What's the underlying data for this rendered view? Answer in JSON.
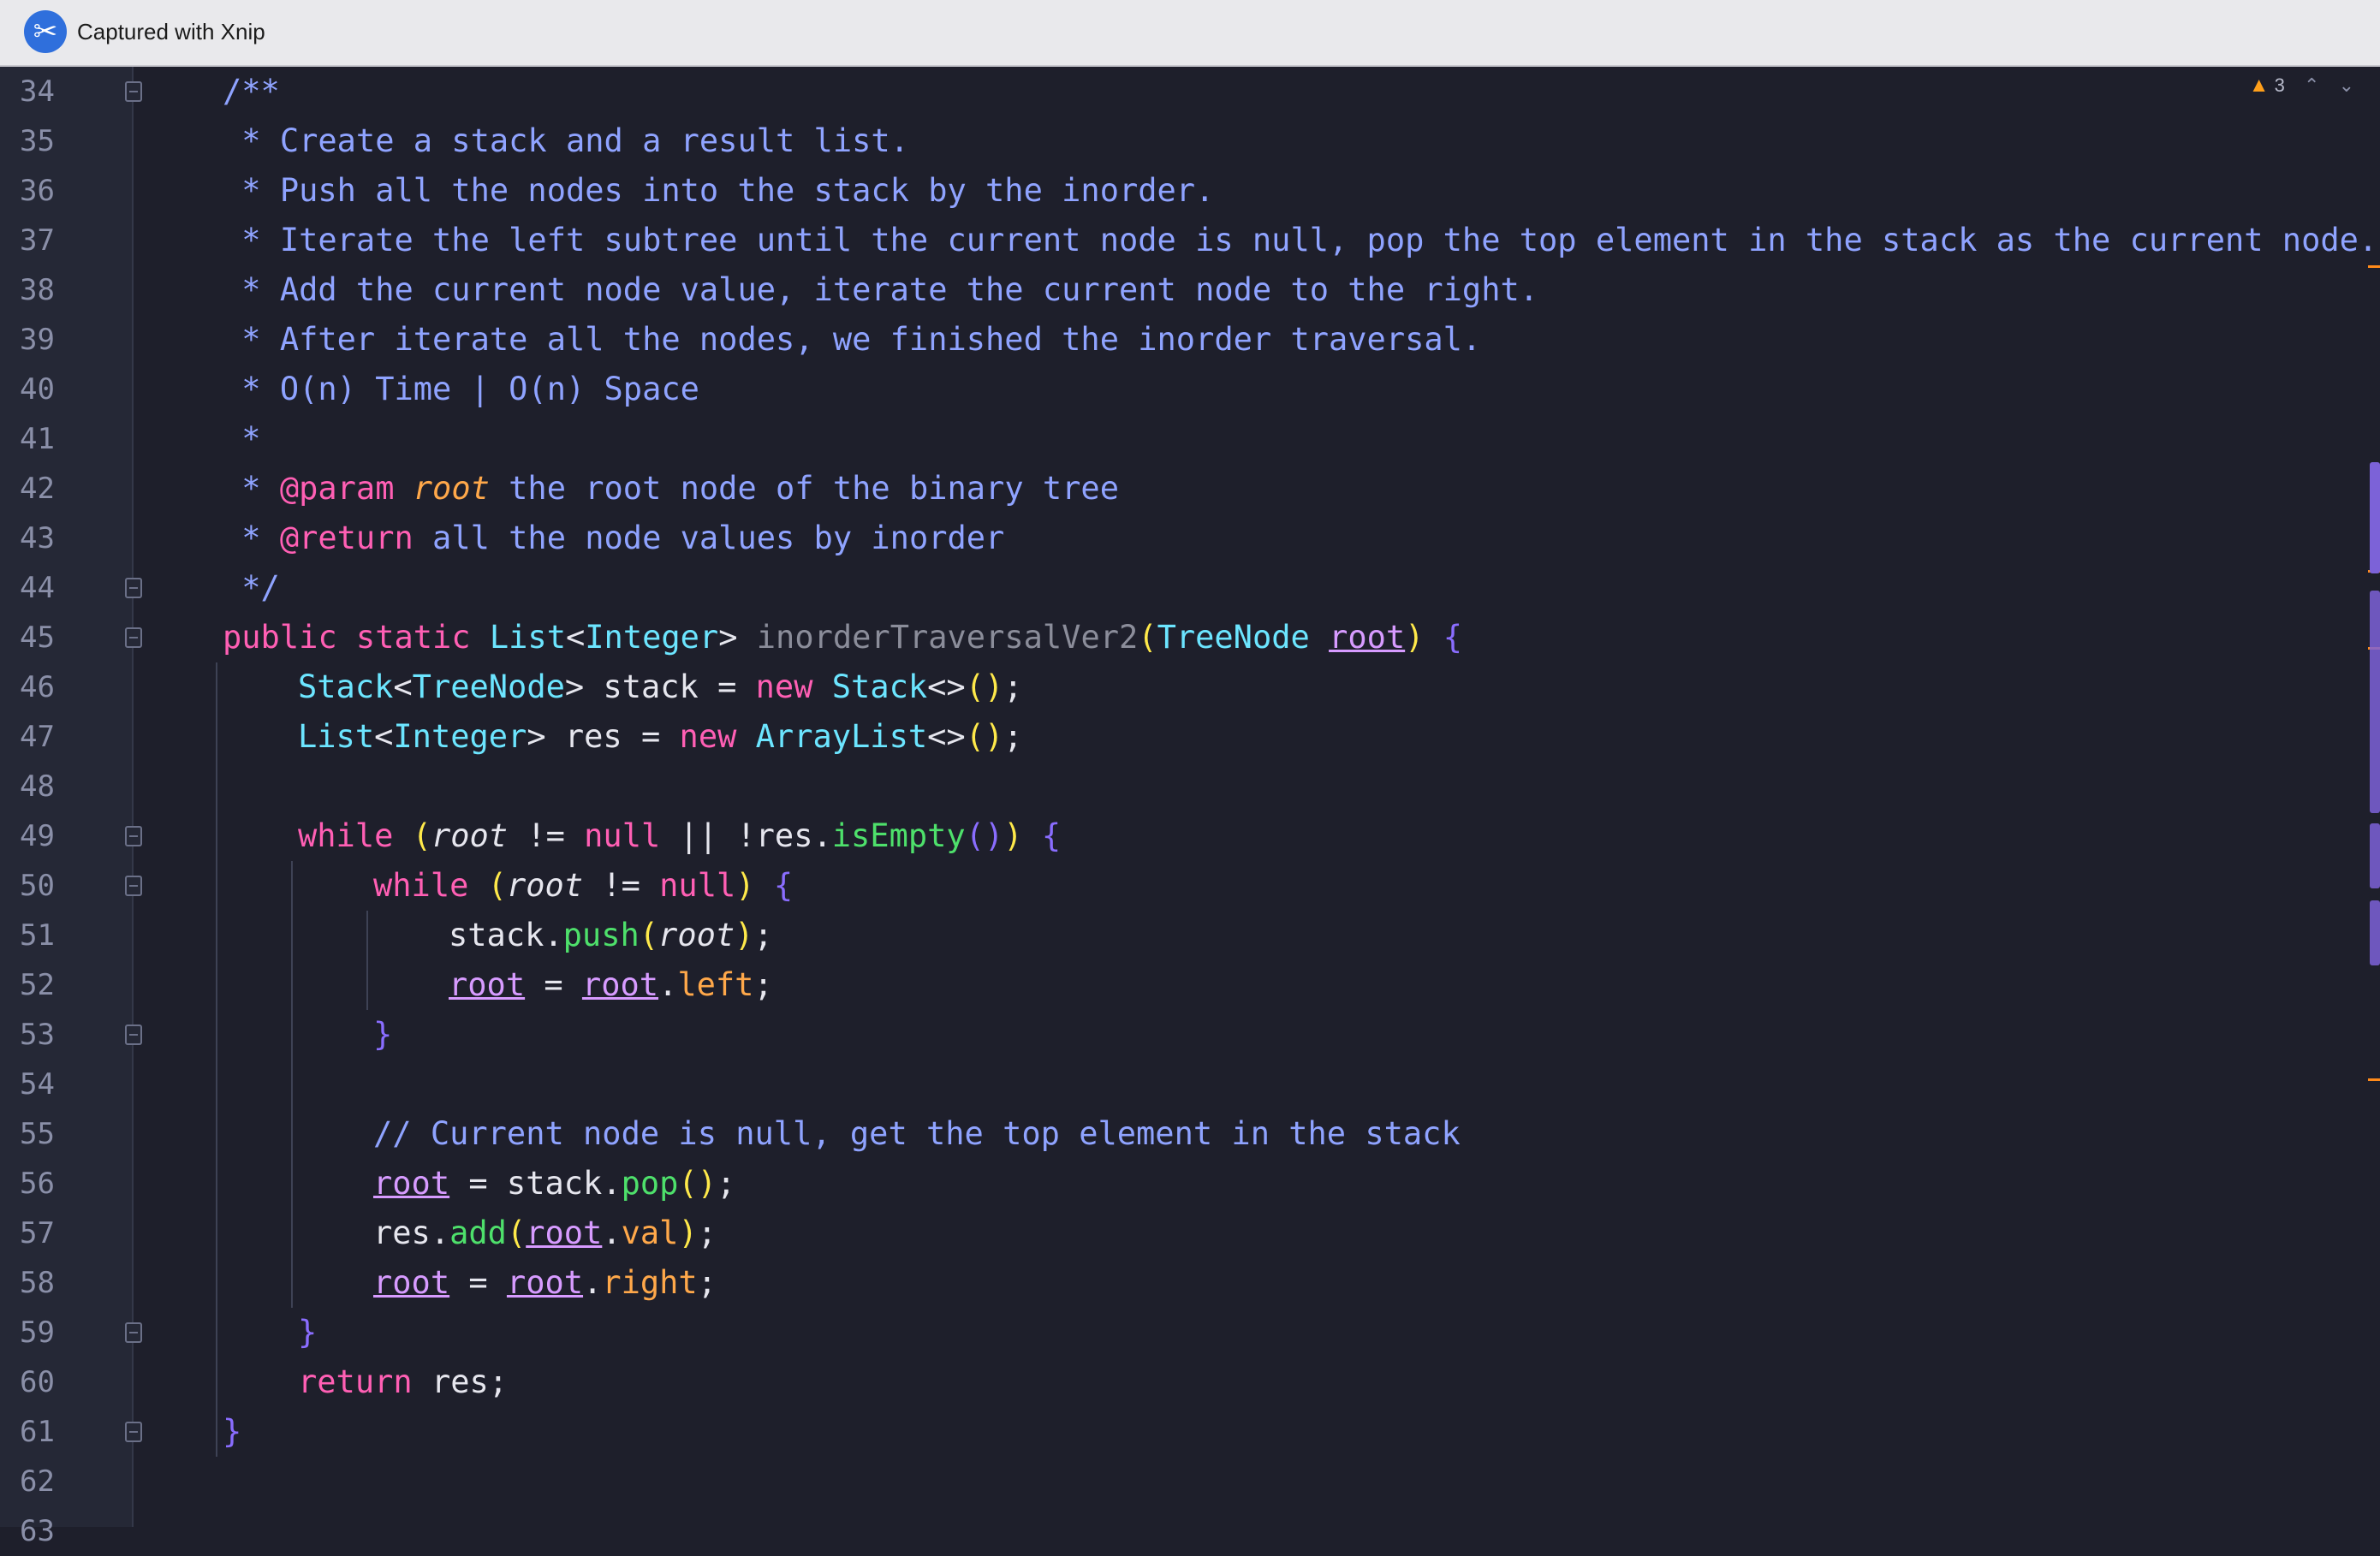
{
  "window": {
    "title": "Captured with Xnip"
  },
  "inspection": {
    "warning_count": "3"
  },
  "lines": [
    {
      "n": "34",
      "fold": true,
      "indent": 0,
      "tokens": [
        [
          "c",
          "/**"
        ]
      ]
    },
    {
      "n": "35",
      "fold": false,
      "indent": 0,
      "tokens": [
        [
          "c",
          " * Create a stack and a result list."
        ]
      ]
    },
    {
      "n": "36",
      "fold": false,
      "indent": 0,
      "tokens": [
        [
          "c",
          " * Push all the nodes into the stack by the inorder."
        ]
      ]
    },
    {
      "n": "37",
      "fold": false,
      "indent": 0,
      "tokens": [
        [
          "c",
          " * Iterate the left subtree until the current node is null, pop the top element in the stack as the current node."
        ]
      ]
    },
    {
      "n": "38",
      "fold": false,
      "indent": 0,
      "tokens": [
        [
          "c",
          " * Add the current node value, iterate the current node to the right."
        ]
      ]
    },
    {
      "n": "39",
      "fold": false,
      "indent": 0,
      "tokens": [
        [
          "c",
          " * After iterate all the nodes, we finished the inorder traversal."
        ]
      ]
    },
    {
      "n": "40",
      "fold": false,
      "indent": 0,
      "tokens": [
        [
          "c",
          " * O(n) Time | O(n) Space"
        ]
      ]
    },
    {
      "n": "41",
      "fold": false,
      "indent": 0,
      "tokens": [
        [
          "c",
          " *"
        ]
      ]
    },
    {
      "n": "42",
      "fold": false,
      "indent": 0,
      "tokens": [
        [
          "c",
          " * "
        ],
        [
          "tag",
          "@param"
        ],
        [
          "c",
          " "
        ],
        [
          "par",
          "root"
        ],
        [
          "c",
          " the root node of the binary tree"
        ]
      ]
    },
    {
      "n": "43",
      "fold": false,
      "indent": 0,
      "tokens": [
        [
          "c",
          " * "
        ],
        [
          "tag",
          "@return"
        ],
        [
          "c",
          " all the node values by inorder"
        ]
      ]
    },
    {
      "n": "44",
      "fold": true,
      "indent": 0,
      "tokens": [
        [
          "c",
          " */"
        ]
      ]
    },
    {
      "n": "45",
      "fold": true,
      "indent": 0,
      "tokens": [
        [
          "kw",
          "public static "
        ],
        [
          "ty",
          "List"
        ],
        [
          "",
          "<"
        ],
        [
          "ty",
          "Integer"
        ],
        [
          "",
          "> "
        ],
        [
          "dim",
          "inorderTraversalVer2"
        ],
        [
          "p1",
          "("
        ],
        [
          "ty",
          "TreeNode "
        ],
        [
          "ul",
          "root"
        ],
        [
          "p1",
          ")"
        ],
        [
          "",
          " "
        ],
        [
          "p2",
          "{"
        ]
      ]
    },
    {
      "n": "46",
      "fold": false,
      "indent": 1,
      "tokens": [
        [
          "ty",
          "Stack"
        ],
        [
          "",
          "<"
        ],
        [
          "ty",
          "TreeNode"
        ],
        [
          "",
          "> stack = "
        ],
        [
          "kw",
          "new "
        ],
        [
          "ty",
          "Stack"
        ],
        [
          "",
          "<>"
        ],
        [
          "p1",
          "()"
        ],
        [
          "",
          ";"
        ]
      ]
    },
    {
      "n": "47",
      "fold": false,
      "indent": 1,
      "tokens": [
        [
          "ty",
          "List"
        ],
        [
          "",
          "<"
        ],
        [
          "ty",
          "Integer"
        ],
        [
          "",
          "> res = "
        ],
        [
          "kw",
          "new "
        ],
        [
          "ty",
          "ArrayList"
        ],
        [
          "",
          "<>"
        ],
        [
          "p1",
          "()"
        ],
        [
          "",
          ";"
        ]
      ]
    },
    {
      "n": "48",
      "fold": false,
      "indent": 0,
      "tokens": []
    },
    {
      "n": "49",
      "fold": true,
      "indent": 1,
      "tokens": [
        [
          "kw",
          "while "
        ],
        [
          "p1",
          "("
        ],
        [
          "it",
          "root"
        ],
        [
          "",
          " != "
        ],
        [
          "kw",
          "null"
        ],
        [
          "",
          " || !res."
        ],
        [
          "fn",
          "isEmpty"
        ],
        [
          "p2",
          "()"
        ],
        [
          "p1",
          ")"
        ],
        [
          "",
          " "
        ],
        [
          "p2",
          "{"
        ]
      ]
    },
    {
      "n": "50",
      "fold": true,
      "indent": 2,
      "tokens": [
        [
          "kw",
          "while "
        ],
        [
          "p1",
          "("
        ],
        [
          "it",
          "root"
        ],
        [
          "",
          " != "
        ],
        [
          "kw",
          "null"
        ],
        [
          "p1",
          ")"
        ],
        [
          "",
          " "
        ],
        [
          "p2",
          "{"
        ]
      ]
    },
    {
      "n": "51",
      "fold": false,
      "indent": 3,
      "tokens": [
        [
          "",
          "stack."
        ],
        [
          "fn",
          "push"
        ],
        [
          "p1",
          "("
        ],
        [
          "it",
          "root"
        ],
        [
          "p1",
          ")"
        ],
        [
          "",
          ";"
        ]
      ]
    },
    {
      "n": "52",
      "fold": false,
      "indent": 3,
      "tokens": [
        [
          "ul",
          "root"
        ],
        [
          "",
          " = "
        ],
        [
          "ul",
          "root"
        ],
        [
          "",
          "."
        ],
        [
          "fd",
          "left"
        ],
        [
          "",
          ";"
        ]
      ]
    },
    {
      "n": "53",
      "fold": true,
      "indent": 2,
      "tokens": [
        [
          "p2",
          "}"
        ]
      ]
    },
    {
      "n": "54",
      "fold": false,
      "indent": 0,
      "tokens": []
    },
    {
      "n": "55",
      "fold": false,
      "indent": 2,
      "tokens": [
        [
          "c",
          "// Current node is null, get the top element in the stack"
        ]
      ]
    },
    {
      "n": "56",
      "fold": false,
      "indent": 2,
      "tokens": [
        [
          "ul",
          "root"
        ],
        [
          "",
          " = stack."
        ],
        [
          "fn",
          "pop"
        ],
        [
          "p1",
          "()"
        ],
        [
          "",
          ";"
        ]
      ]
    },
    {
      "n": "57",
      "fold": false,
      "indent": 2,
      "tokens": [
        [
          "",
          "res."
        ],
        [
          "fn",
          "add"
        ],
        [
          "p1",
          "("
        ],
        [
          "ul",
          "root"
        ],
        [
          "",
          "."
        ],
        [
          "fd",
          "val"
        ],
        [
          "p1",
          ")"
        ],
        [
          "",
          ";"
        ]
      ]
    },
    {
      "n": "58",
      "fold": false,
      "indent": 2,
      "tokens": [
        [
          "ul",
          "root"
        ],
        [
          "",
          " = "
        ],
        [
          "ul",
          "root"
        ],
        [
          "",
          "."
        ],
        [
          "fd",
          "right"
        ],
        [
          "",
          ";"
        ]
      ]
    },
    {
      "n": "59",
      "fold": true,
      "indent": 1,
      "tokens": [
        [
          "p2",
          "}"
        ]
      ]
    },
    {
      "n": "60",
      "fold": false,
      "indent": 1,
      "tokens": [
        [
          "kw",
          "return "
        ],
        [
          "",
          "res;"
        ]
      ]
    },
    {
      "n": "61",
      "fold": true,
      "indent": 0,
      "tokens": [
        [
          "p2",
          "}"
        ]
      ]
    },
    {
      "n": "62",
      "fold": false,
      "indent": 0,
      "tokens": []
    },
    {
      "n": "63",
      "fold": false,
      "indent": 0,
      "tokens": []
    }
  ]
}
